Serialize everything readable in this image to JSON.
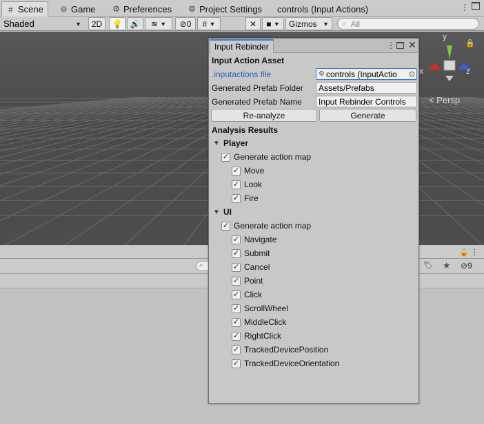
{
  "tabs": [
    {
      "label": "Scene",
      "icon": "grid-icon",
      "active": true
    },
    {
      "label": "Game",
      "icon": "gamepad-icon",
      "active": false
    },
    {
      "label": "Preferences",
      "icon": "gear-icon",
      "active": false
    },
    {
      "label": "Project Settings",
      "icon": "gear-icon",
      "active": false
    },
    {
      "label": "controls (Input Actions)",
      "icon": "",
      "active": false
    }
  ],
  "toolbar": {
    "draw_mode": "Shaded",
    "mode_2d": "2D",
    "hidden_count": "0",
    "gizmos": "Gizmos",
    "search_placeholder": "All"
  },
  "scene": {
    "gizmo_axes": {
      "x": "x",
      "y": "y",
      "z": "z"
    },
    "projection": "< Persp",
    "colors": {
      "x": "#d42b2b",
      "y": "#7ec83a",
      "z": "#3a5fd4"
    }
  },
  "lower_panel": {
    "visible_count": "9"
  },
  "rebinder": {
    "title": "Input Rebinder",
    "section_asset": "Input Action Asset",
    "asset_label": ".inputactions file",
    "asset_value": "controls (InputActio",
    "prefab_folder_label": "Generated Prefab Folder",
    "prefab_folder_value": "Assets/Prefabs",
    "prefab_name_label": "Generated Prefab Name",
    "prefab_name_value": "Input Rebinder Controls",
    "reanalyze_label": "Re-analyze",
    "generate_label": "Generate",
    "section_results": "Analysis Results",
    "maps": [
      {
        "name": "Player",
        "generate_label": "Generate action map",
        "generate_checked": true,
        "actions": [
          {
            "name": "Move",
            "checked": true
          },
          {
            "name": "Look",
            "checked": true
          },
          {
            "name": "Fire",
            "checked": true
          }
        ]
      },
      {
        "name": "UI",
        "generate_label": "Generate action map",
        "generate_checked": true,
        "actions": [
          {
            "name": "Navigate",
            "checked": true
          },
          {
            "name": "Submit",
            "checked": true
          },
          {
            "name": "Cancel",
            "checked": true
          },
          {
            "name": "Point",
            "checked": true
          },
          {
            "name": "Click",
            "checked": true
          },
          {
            "name": "ScrollWheel",
            "checked": true
          },
          {
            "name": "MiddleClick",
            "checked": true
          },
          {
            "name": "RightClick",
            "checked": true
          },
          {
            "name": "TrackedDevicePosition",
            "checked": true
          },
          {
            "name": "TrackedDeviceOrientation",
            "checked": true
          }
        ]
      }
    ]
  },
  "check_glyph": "✓",
  "fold_glyph": "▼"
}
